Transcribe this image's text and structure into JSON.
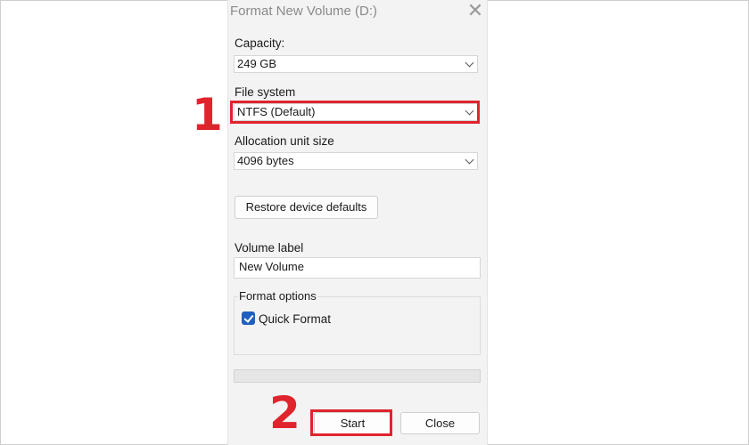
{
  "dialog": {
    "title": "Format New Volume (D:)",
    "close_glyph": "✕",
    "capacity": {
      "label": "Capacity:",
      "value": "249 GB"
    },
    "file_system": {
      "label": "File system",
      "value": "NTFS (Default)"
    },
    "allocation": {
      "label": "Allocation unit size",
      "value": "4096 bytes"
    },
    "restore_button": "Restore device defaults",
    "volume_label": {
      "label": "Volume label",
      "value": "New Volume"
    },
    "format_options": {
      "label": "Format options",
      "quick_format": "Quick Format",
      "quick_format_checked": true
    },
    "progress": 0,
    "start_button": "Start",
    "close_button": "Close"
  },
  "callouts": {
    "step1": "1",
    "step2": "2"
  },
  "colors": {
    "highlight": "#e0242d",
    "checkbox": "#1f5fbf",
    "dialog_bg": "#f3f3f3"
  },
  "icons": [
    "close-icon",
    "chevron-down-icon",
    "checkmark-icon"
  ]
}
